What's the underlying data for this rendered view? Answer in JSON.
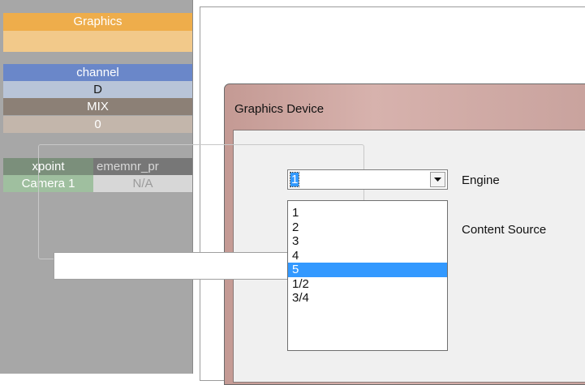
{
  "left_panel": {
    "graphics": "Graphics",
    "channel": "channel",
    "d": "D",
    "mix": "MIX",
    "zero": "0",
    "xpoint": "xpoint",
    "xpoint_value": "ememnr_pr",
    "camera": "Camera 1",
    "camera_value": "N/A"
  },
  "dialog": {
    "title": "Graphics Device",
    "engine_label": "Engine",
    "content_source_label": "Content Source",
    "engine_combo": {
      "value": "1",
      "options": [
        "1",
        "2",
        "3",
        "4",
        "5",
        "1/2",
        "3/4"
      ],
      "highlighted": "5"
    }
  },
  "colors": {
    "graphics_header": "#eead4b",
    "channel_header": "#6a87c9",
    "selection": "#3399ff"
  }
}
